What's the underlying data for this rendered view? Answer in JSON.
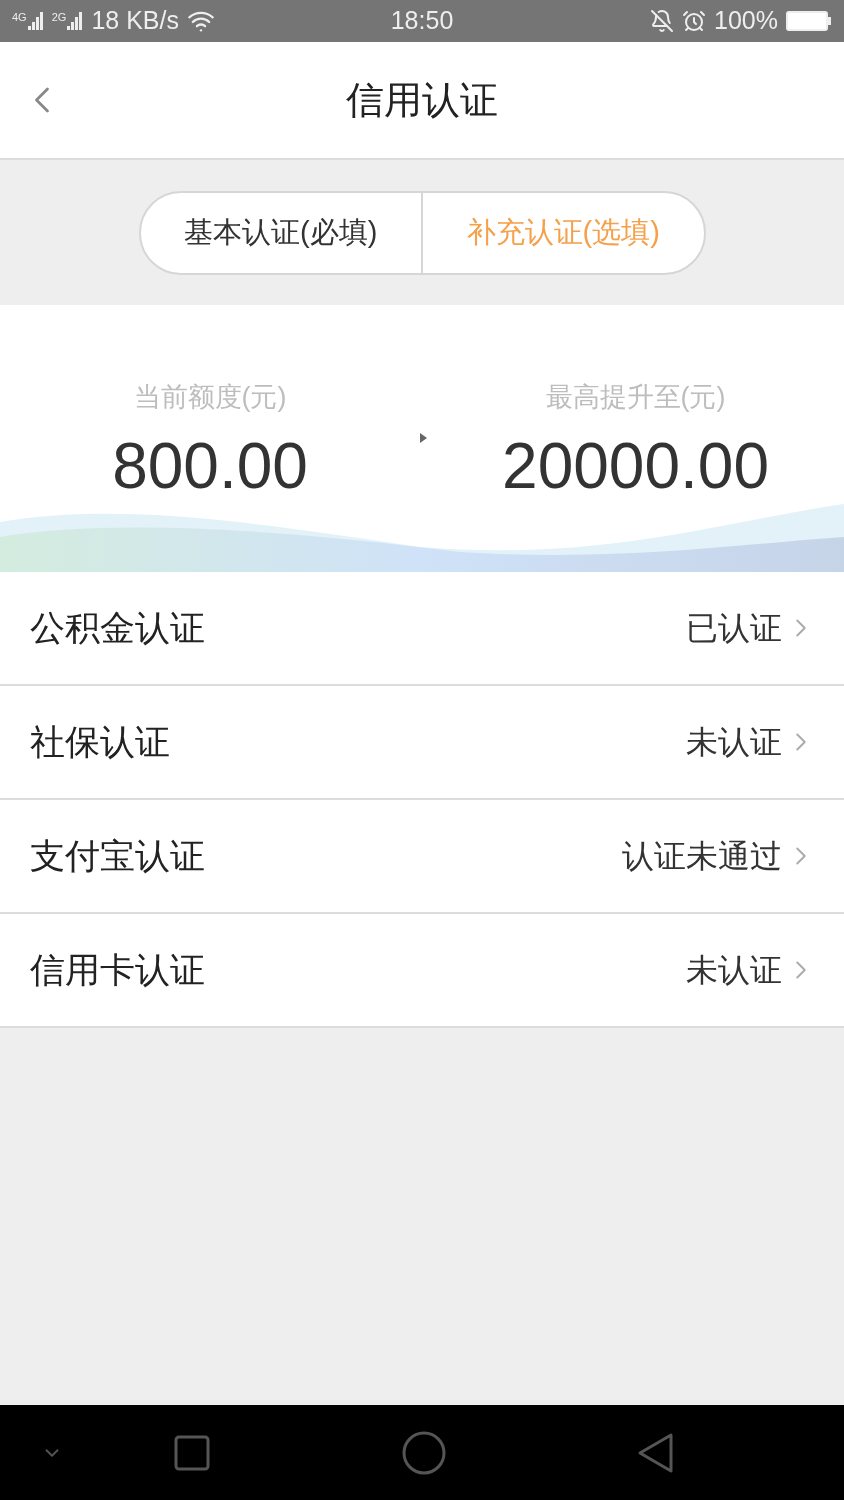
{
  "status_bar": {
    "network_1": "4G",
    "network_2": "2G",
    "speed": "18 KB/s",
    "time": "18:50",
    "battery": "100%"
  },
  "header": {
    "title": "信用认证"
  },
  "tabs": [
    {
      "label": "基本认证(必填)",
      "selected": false
    },
    {
      "label": "补充认证(选填)",
      "selected": true
    }
  ],
  "limits": {
    "current_label": "当前额度(元)",
    "current_value": "800.00",
    "max_label": "最高提升至(元)",
    "max_value": "20000.00"
  },
  "items": [
    {
      "name": "公积金认证",
      "status": "已认证"
    },
    {
      "name": "社保认证",
      "status": "未认证"
    },
    {
      "name": "支付宝认证",
      "status": "认证未通过"
    },
    {
      "name": "信用卡认证",
      "status": "未认证"
    }
  ]
}
